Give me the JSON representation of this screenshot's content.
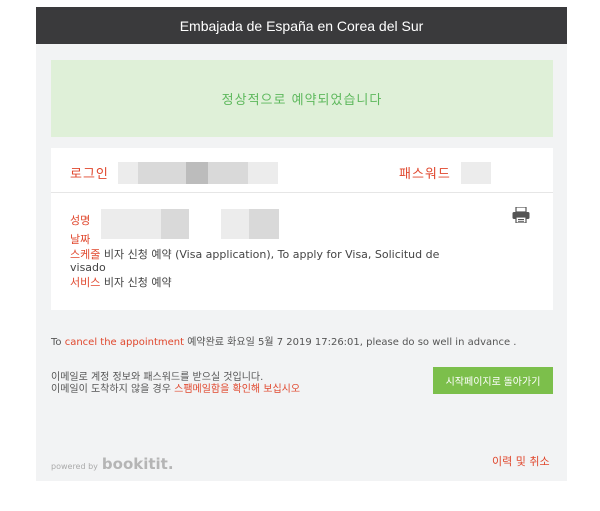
{
  "header": {
    "title": "Embajada de España en Corea del Sur"
  },
  "success_message": "정상적으로 예약되었습니다",
  "credentials": {
    "login_label": "로그인",
    "password_label": "패스워드"
  },
  "details": {
    "name_label": "성명",
    "date_label": "날짜",
    "schedule_label": "스케줄",
    "schedule_value": "비자 신청 예약 (Visa application), To apply for Visa, Solicitud de",
    "schedule_value_cont": "visado",
    "service_label": "서비스",
    "service_value": "비자 신청 예약"
  },
  "icons": {
    "print": "printer-icon"
  },
  "notice": {
    "prefix": "To ",
    "link": "cancel the appointment",
    "text": " 예약완료 화요일 5월 7 2019 17:26:01, please do so well in advance ."
  },
  "mail_note": {
    "line1": "이메일로 계정 정보와 패스워드를 받으실 것입니다.",
    "line2_prefix": "이메일이 도착하지 않을 경우 ",
    "line2_link": "스팸메일함을 확인해 보십시오"
  },
  "buttons": {
    "start_page": "시작페이지로 돌아가기",
    "history_cancel": "이력 및 취소"
  },
  "footer": {
    "powered_by": "powered by",
    "brand": "bookitit."
  },
  "colors": {
    "accent_red": "#e0472d",
    "success_green": "#5db85c",
    "button_green": "#7cbf4b",
    "header_bg": "#3a3a3c"
  }
}
